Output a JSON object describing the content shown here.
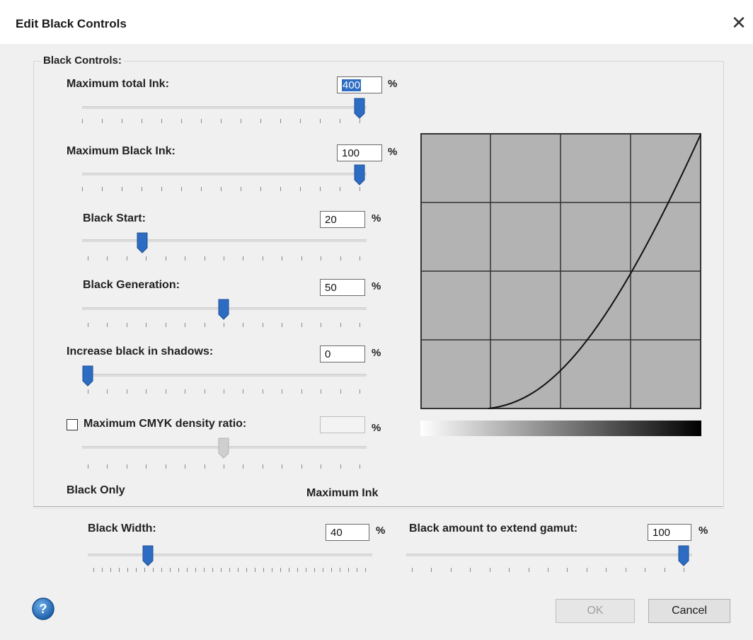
{
  "dialog": {
    "title": "Edit Black Controls",
    "close_glyph": "✕"
  },
  "group": {
    "label": "Black Controls:"
  },
  "controls": {
    "max_total_ink": {
      "label": "Maximum total Ink:",
      "value": "400",
      "unit": "%",
      "level_pct": 100
    },
    "max_black_ink": {
      "label": "Maximum Black Ink:",
      "value": "100",
      "unit": "%",
      "level_pct": 100
    },
    "black_start": {
      "label": "Black Start:",
      "value": "20",
      "unit": "%",
      "level_pct": 20
    },
    "black_generation": {
      "label": "Black Generation:",
      "value": "50",
      "unit": "%",
      "level_pct": 50
    },
    "increase_black_shadows": {
      "label": "Increase black in shadows:",
      "value": "0",
      "unit": "%",
      "level_pct": 0
    },
    "max_cmyk_density": {
      "label": "Maximum CMYK density ratio:",
      "value": "",
      "unit": "%",
      "checked": false,
      "enabled": false,
      "level_pct": 50
    },
    "black_width": {
      "label": "Black Width:",
      "value": "40",
      "unit": "%",
      "level_pct": 20
    },
    "black_extend_gamut": {
      "label": "Black amount to extend gamut:",
      "value": "100",
      "unit": "%",
      "level_pct": 100
    }
  },
  "scale_labels": {
    "left": "Black Only",
    "right": "Maximum Ink"
  },
  "buttons": {
    "ok": "OK",
    "cancel": "Cancel",
    "help_glyph": "?"
  },
  "colors": {
    "accent": "#2d6cc3",
    "chart_fill": "#b3b3b3",
    "grid": "#333333"
  }
}
